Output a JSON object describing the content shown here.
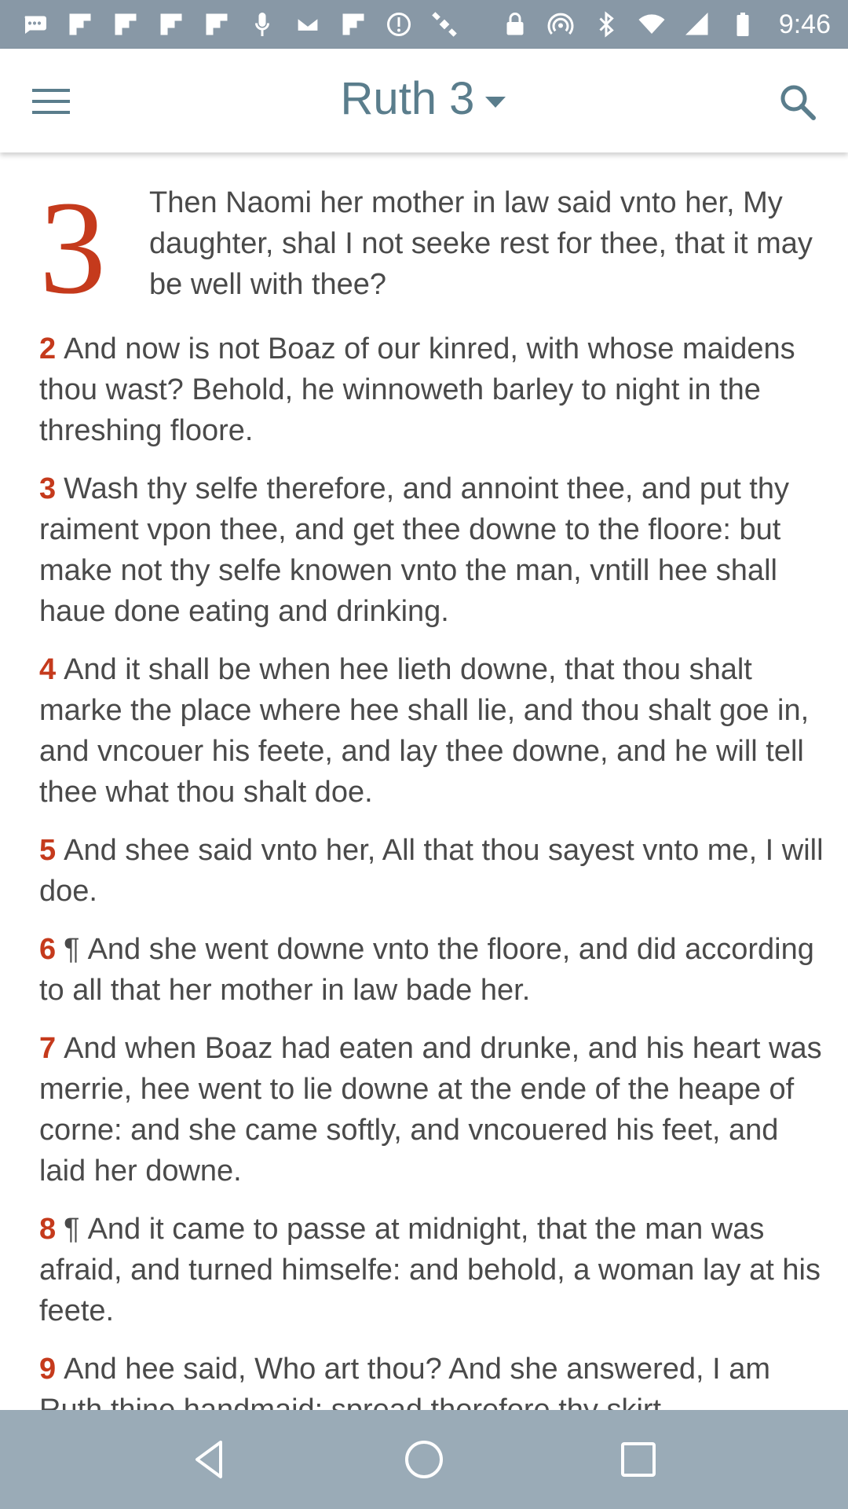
{
  "status_bar": {
    "time": "9:46",
    "left_icons": [
      "chat-icon",
      "flipboard-icon",
      "flipboard-icon",
      "flipboard-icon",
      "flipboard-icon",
      "mic-icon",
      "mail-icon",
      "flipboard-icon",
      "info-icon",
      "satellite-icon"
    ],
    "right_icons": [
      "lock-icon",
      "hotspot-icon",
      "bluetooth-icon",
      "wifi-icon",
      "signal-icon",
      "battery-icon"
    ]
  },
  "app_bar": {
    "title": "Ruth 3"
  },
  "chapter": {
    "drop_cap": "3",
    "first_verse": "Then Naomi her mother in law said vnto her, My daughter, shal I not seeke rest for thee, that it may be well with thee?",
    "verses": [
      {
        "num": "2",
        "pilcrow": "",
        "text": "And now is not Boaz of our kinred, with whose maidens thou wast? Behold, he winnoweth barley to night in the threshing floore."
      },
      {
        "num": "3",
        "pilcrow": "",
        "text": "Wash thy selfe therefore, and annoint thee, and put thy raiment vpon thee, and get thee downe to the floore: but make not thy selfe knowen vnto the man, vntill hee shall haue done eating and drinking."
      },
      {
        "num": "4",
        "pilcrow": "",
        "text": "And it shall be when hee lieth downe, that thou shalt marke the place where hee shall lie, and thou shalt goe in, and vncouer his feete, and lay thee downe, and he will tell thee what thou shalt doe."
      },
      {
        "num": "5",
        "pilcrow": "",
        "text": "And shee said vnto her, All that thou sayest vnto me, I will doe."
      },
      {
        "num": "6",
        "pilcrow": "¶",
        "text": "And she went downe vnto the floore, and did according to all that her mother in law bade her."
      },
      {
        "num": "7",
        "pilcrow": "",
        "text": "And when Boaz had eaten and drunke, and his heart was merrie, hee went to lie downe at the ende of the heape of corne: and she came softly, and vncouered his feet, and laid her downe."
      },
      {
        "num": "8",
        "pilcrow": "¶",
        "text": "And it came to passe at midnight, that the man was afraid, and turned himselfe: and behold, a woman lay at his feete."
      },
      {
        "num": "9",
        "pilcrow": "",
        "text": "And hee said, Who art thou? And she answered, I am Ruth thine handmaid: spread therefore thy skirt"
      }
    ]
  },
  "colors": {
    "accent": "#c53a1c",
    "title": "#5a7d8c",
    "status_bar": "#8898a6",
    "nav_bar": "#9aabb7"
  }
}
